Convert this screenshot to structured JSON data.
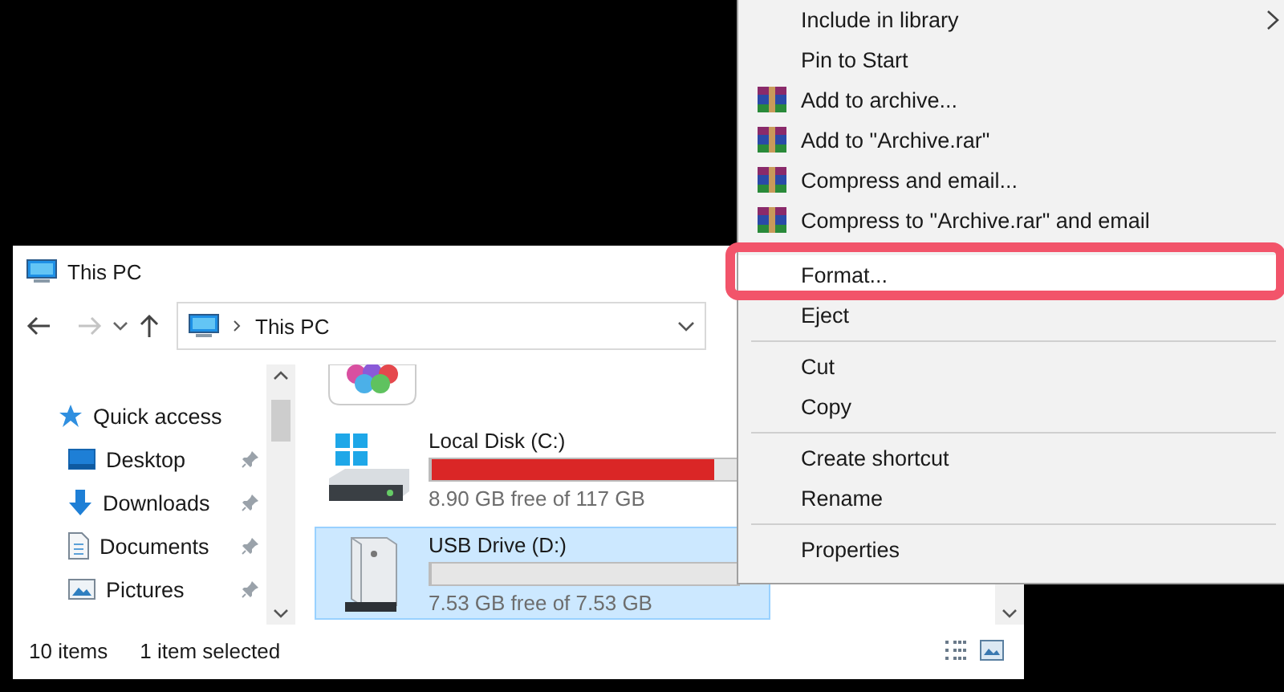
{
  "window": {
    "title": "This PC",
    "address": "This PC"
  },
  "sidebar": {
    "items": [
      {
        "label": "Quick access",
        "kind": "star",
        "pinned": false
      },
      {
        "label": "Desktop",
        "kind": "desktop",
        "pinned": true
      },
      {
        "label": "Downloads",
        "kind": "downloads",
        "pinned": true
      },
      {
        "label": "Documents",
        "kind": "documents",
        "pinned": true
      },
      {
        "label": "Pictures",
        "kind": "pictures",
        "pinned": true
      }
    ]
  },
  "drives": [
    {
      "name": "Local Disk (C:)",
      "kind": "system",
      "free": "8.90 GB free of 117 GB",
      "level": 0.92,
      "selected": false
    },
    {
      "name": "USB Drive (D:)",
      "kind": "usb",
      "free": "7.53 GB free of 7.53 GB",
      "level": 0,
      "selected": true
    }
  ],
  "status_bar": {
    "count": "10 items",
    "selection": "1 item selected"
  },
  "context_menu": {
    "items": [
      {
        "kind": "item",
        "label": "Include in library",
        "archive_icon": false,
        "submenu": true,
        "highlighted": false
      },
      {
        "kind": "item",
        "label": "Pin to Start",
        "archive_icon": false,
        "submenu": false,
        "highlighted": false
      },
      {
        "kind": "item",
        "label": "Add to archive...",
        "archive_icon": true,
        "submenu": false,
        "highlighted": false
      },
      {
        "kind": "item",
        "label": "Add to \"Archive.rar\"",
        "archive_icon": true,
        "submenu": false,
        "highlighted": false
      },
      {
        "kind": "item",
        "label": "Compress and email...",
        "archive_icon": true,
        "submenu": false,
        "highlighted": false
      },
      {
        "kind": "item",
        "label": "Compress to \"Archive.rar\" and email",
        "archive_icon": true,
        "submenu": false,
        "highlighted": false
      },
      {
        "kind": "gap"
      },
      {
        "kind": "item",
        "label": "Format...",
        "archive_icon": false,
        "submenu": false,
        "highlighted": true
      },
      {
        "kind": "item",
        "label": "Eject",
        "archive_icon": false,
        "submenu": false,
        "highlighted": false
      },
      {
        "kind": "separator"
      },
      {
        "kind": "item",
        "label": "Cut",
        "archive_icon": false,
        "submenu": false,
        "highlighted": false
      },
      {
        "kind": "item",
        "label": "Copy",
        "archive_icon": false,
        "submenu": false,
        "highlighted": false
      },
      {
        "kind": "separator"
      },
      {
        "kind": "item",
        "label": "Create shortcut",
        "archive_icon": false,
        "submenu": false,
        "highlighted": false
      },
      {
        "kind": "item",
        "label": "Rename",
        "archive_icon": false,
        "submenu": false,
        "highlighted": false
      },
      {
        "kind": "separator"
      },
      {
        "kind": "item",
        "label": "Properties",
        "archive_icon": false,
        "submenu": false,
        "highlighted": false
      }
    ]
  }
}
